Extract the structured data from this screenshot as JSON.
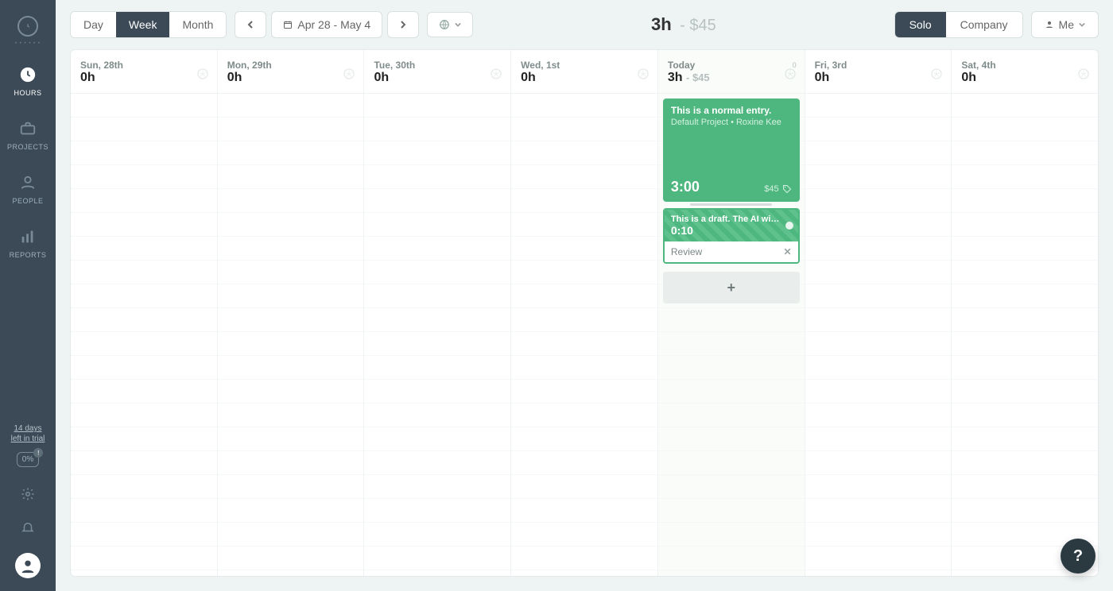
{
  "sidebar": {
    "nav": [
      {
        "key": "hours",
        "label": "HOURS",
        "active": true
      },
      {
        "key": "projects",
        "label": "PROJECTS",
        "active": false
      },
      {
        "key": "people",
        "label": "PEOPLE",
        "active": false
      },
      {
        "key": "reports",
        "label": "REPORTS",
        "active": false
      }
    ],
    "trial_line1": "14 days",
    "trial_line2": "left in trial",
    "progress": "0%"
  },
  "toolbar": {
    "views": {
      "day": "Day",
      "week": "Week",
      "month": "Month",
      "active": "week"
    },
    "date_range": "Apr 28 - May 4",
    "totals": {
      "hours": "3h",
      "amount": "- $45"
    },
    "scope": {
      "solo": "Solo",
      "company": "Company",
      "active": "solo"
    },
    "user_filter": "Me"
  },
  "days": [
    {
      "label": "Sun, 28th",
      "hours": "0h",
      "amount": "",
      "today": false
    },
    {
      "label": "Mon, 29th",
      "hours": "0h",
      "amount": "",
      "today": false
    },
    {
      "label": "Tue, 30th",
      "hours": "0h",
      "amount": "",
      "today": false
    },
    {
      "label": "Wed, 1st",
      "hours": "0h",
      "amount": "",
      "today": false
    },
    {
      "label": "Today",
      "hours": "3h",
      "amount": "- $45",
      "today": true,
      "entries": [
        {
          "type": "normal",
          "title": "This is a normal entry.",
          "project": "Default Project",
          "person": "Roxine Kee",
          "duration": "3:00",
          "price": "$45"
        },
        {
          "type": "draft",
          "title": "This is a draft. The AI wi…",
          "duration": "0:10",
          "action": "Review"
        }
      ]
    },
    {
      "label": "Fri, 3rd",
      "hours": "0h",
      "amount": "",
      "today": false
    },
    {
      "label": "Sat, 4th",
      "hours": "0h",
      "amount": "",
      "today": false
    }
  ],
  "icons": {
    "plus": "+",
    "help": "?"
  }
}
